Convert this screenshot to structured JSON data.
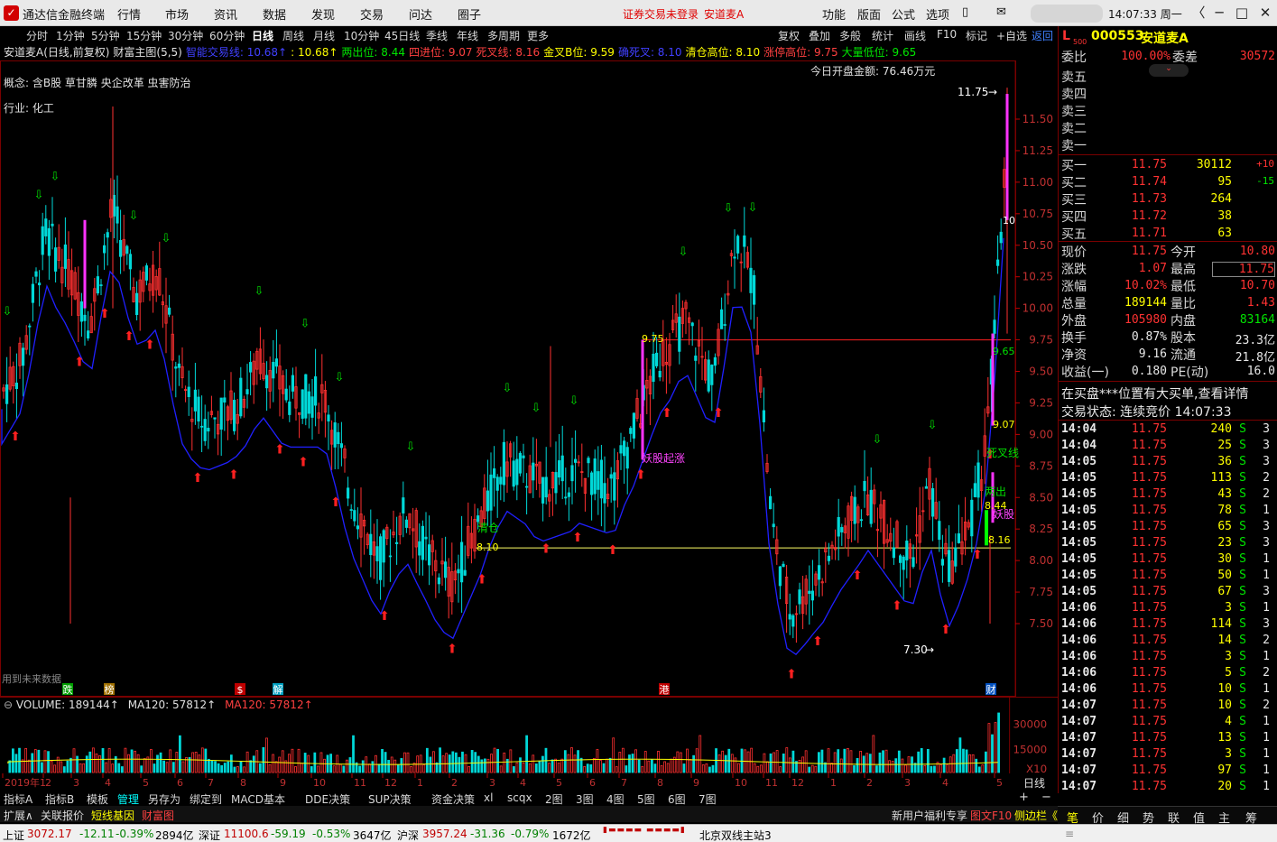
{
  "window": {
    "title": "通达信金融终端",
    "menu": [
      "行情",
      "市场",
      "资讯",
      "数据",
      "发现",
      "交易",
      "问达",
      "圈子"
    ],
    "login_notice": "证券交易未登录",
    "login_stock": "安道麦A",
    "tools": [
      "功能",
      "版面",
      "公式",
      "选项"
    ],
    "clock": "14:07:33 周一"
  },
  "periods": [
    "分时",
    "1分钟",
    "5分钟",
    "15分钟",
    "30分钟",
    "60分钟",
    "日线",
    "周线",
    "月线",
    "10分钟",
    "45日线",
    "季线",
    "年线",
    "多周期",
    "更多"
  ],
  "period_active": "日线",
  "chart_tools": [
    "复权",
    "叠加",
    "多般",
    "统计",
    "画线",
    "F10",
    "标记",
    "+自选",
    "返回"
  ],
  "indicator_bar": [
    {
      "t": "安道麦A(日线,前复权)",
      "c": "#e0e0e0"
    },
    {
      "t": "财富主图(5,5)",
      "c": "#e0e0e0"
    },
    {
      "t": "智能交易线: 10.68↑",
      "c": "#4040ff"
    },
    {
      "t": ": 10.68↑",
      "c": "#ffff00"
    },
    {
      "t": "两出位: 8.44",
      "c": "#00e600"
    },
    {
      "t": "四进位: 9.07",
      "c": "#ff4040"
    },
    {
      "t": "死叉线: 8.16",
      "c": "#ff4040"
    },
    {
      "t": "金叉B位: 9.59",
      "c": "#ffff00"
    },
    {
      "t": "确死叉: 8.10",
      "c": "#4040ff"
    },
    {
      "t": "清仓高位: 8.10",
      "c": "#ffff00"
    },
    {
      "t": "涨停高位: 9.75",
      "c": "#ff4040"
    },
    {
      "t": "大量低位: 9.65",
      "c": "#00e600"
    }
  ],
  "concept": "概念: 含B股 草甘膦 央企改革 虫害防治",
  "industry": "行业: 化工",
  "open_amount": "今日开盘金额: 76.46万元",
  "annotations": {
    "hi": "11.75",
    "lo": "7.30",
    "l975": "9.75",
    "l810": "8.10",
    "yaoqi": "妖股起涨",
    "qingcang": "清仓",
    "r907": "9.07",
    "r844": "8.44",
    "r816": "8.16",
    "r965": "9.65",
    "sicha": "死叉线",
    "liangchu": "两出",
    "yaogu": "妖股",
    "weilai": "用到未来数据",
    "r10": "10"
  },
  "price_axis": [
    "11.50",
    "11.25",
    "11.00",
    "10.75",
    "10.50",
    "10.25",
    "10.00",
    "9.75",
    "9.50",
    "9.25",
    "9.00",
    "8.75",
    "8.50",
    "8.25",
    "8.00",
    "7.75",
    "7.50"
  ],
  "chart_data": {
    "type": "candlestick",
    "title": "安道麦A(日线,前复权)",
    "high": 11.75,
    "low": 7.3,
    "last_close": 11.75,
    "levels": {
      "涨停高位": 9.75,
      "清仓高位": 8.1
    },
    "volume": {
      "label": "VOLUME: 189144↑",
      "ma120": "MA120: 57812↑",
      "ma120b": "MA120: 57812↑",
      "axis": [
        "30000",
        "15000",
        "X10"
      ]
    }
  },
  "month_labels": [
    "2019年1",
    "2",
    "3",
    "4",
    "5",
    "6",
    "7",
    "8",
    "9",
    "10",
    "11",
    "12",
    "1",
    "2",
    "3",
    "4",
    "5",
    "6",
    "7",
    "8",
    "9",
    "10",
    "11",
    "12",
    "1",
    "2",
    "3",
    "4",
    "5"
  ],
  "event_marks": [
    "跌",
    "榜",
    "$",
    "解",
    "港",
    "财"
  ],
  "x_period": "日线",
  "bottom_tabs": [
    "指标A",
    "指标B",
    "模板",
    "管理",
    "另存为",
    "绑定到",
    "MACD基本",
    "DDE决策",
    "SUP决策",
    "资金决策",
    "xl",
    "scqx",
    "2图",
    "3图",
    "4图",
    "5图",
    "6图",
    "7图"
  ],
  "row2": {
    "l": [
      "扩展∧",
      "关联报价",
      "短线基因",
      "财富图"
    ],
    "r": [
      "新用户福利专享",
      "图文F10",
      "侧边栏《"
    ]
  },
  "quote": {
    "code": "000553",
    "name": "安道麦A",
    "weibi": "100.00%",
    "weicha": "30572",
    "sell": [
      {
        "l": "卖五"
      },
      {
        "l": "卖四"
      },
      {
        "l": "卖三"
      },
      {
        "l": "卖二"
      },
      {
        "l": "卖一"
      }
    ],
    "buy": [
      {
        "l": "买一",
        "p": "11.75",
        "v": "30112",
        "d": "+10"
      },
      {
        "l": "买二",
        "p": "11.74",
        "v": "95",
        "d": "-15"
      },
      {
        "l": "买三",
        "p": "11.73",
        "v": "264",
        "d": ""
      },
      {
        "l": "买四",
        "p": "11.72",
        "v": "38",
        "d": ""
      },
      {
        "l": "买五",
        "p": "11.71",
        "v": "63",
        "d": ""
      }
    ],
    "stats": [
      [
        "现价",
        "11.75",
        "今开",
        "10.80"
      ],
      [
        "涨跌",
        "1.07",
        "最高",
        "11.75"
      ],
      [
        "涨幅",
        "10.02%",
        "最低",
        "10.70"
      ],
      [
        "总量",
        "189144",
        "量比",
        "1.43"
      ],
      [
        "外盘",
        "105980",
        "内盘",
        "83164"
      ],
      [
        "换手",
        "0.87%",
        "股本",
        "23.3亿"
      ],
      [
        "净资",
        "9.16",
        "流通",
        "21.8亿"
      ],
      [
        "收益(一)",
        "0.180",
        "PE(动)",
        "16.0"
      ]
    ],
    "notice": "在买盘***位置有大买单,查看详情",
    "state": "交易状态: 连续竞价 14:07:33",
    "ticks": [
      [
        "14:04",
        "11.75",
        "240",
        "3"
      ],
      [
        "14:04",
        "11.75",
        "25",
        "3"
      ],
      [
        "14:05",
        "11.75",
        "36",
        "3"
      ],
      [
        "14:05",
        "11.75",
        "113",
        "2"
      ],
      [
        "14:05",
        "11.75",
        "43",
        "2"
      ],
      [
        "14:05",
        "11.75",
        "78",
        "1"
      ],
      [
        "14:05",
        "11.75",
        "65",
        "3"
      ],
      [
        "14:05",
        "11.75",
        "23",
        "3"
      ],
      [
        "14:05",
        "11.75",
        "30",
        "1"
      ],
      [
        "14:05",
        "11.75",
        "50",
        "1"
      ],
      [
        "14:05",
        "11.75",
        "67",
        "3"
      ],
      [
        "14:06",
        "11.75",
        "3",
        "1"
      ],
      [
        "14:06",
        "11.75",
        "114",
        "3"
      ],
      [
        "14:06",
        "11.75",
        "14",
        "2"
      ],
      [
        "14:06",
        "11.75",
        "3",
        "1"
      ],
      [
        "14:06",
        "11.75",
        "5",
        "2"
      ],
      [
        "14:06",
        "11.75",
        "10",
        "1"
      ],
      [
        "14:07",
        "11.75",
        "10",
        "2"
      ],
      [
        "14:07",
        "11.75",
        "4",
        "1"
      ],
      [
        "14:07",
        "11.75",
        "13",
        "1"
      ],
      [
        "14:07",
        "11.75",
        "3",
        "1"
      ],
      [
        "14:07",
        "11.75",
        "97",
        "1"
      ],
      [
        "14:07",
        "11.75",
        "20",
        "1"
      ]
    ],
    "tick_side": "S"
  },
  "right_tabs": [
    "笔",
    "价",
    "细",
    "势",
    "联",
    "值",
    "主",
    "筹"
  ],
  "status": {
    "sh": "上证",
    "sh_v": "3072.17",
    "sh_c": "-12.11",
    "sh_p": "-0.39%",
    "sh_a": "2894亿",
    "sz": "深证",
    "sz_v": "11100.6",
    "sz_c": "-59.19",
    "sz_p": "-0.53%",
    "sz_a": "3647亿",
    "hs": "沪深",
    "hs_v": "3957.24",
    "hs_c": "-31.36",
    "hs_p": "-0.79%",
    "hs_a": "1672亿",
    "site": "北京双线主站3"
  }
}
